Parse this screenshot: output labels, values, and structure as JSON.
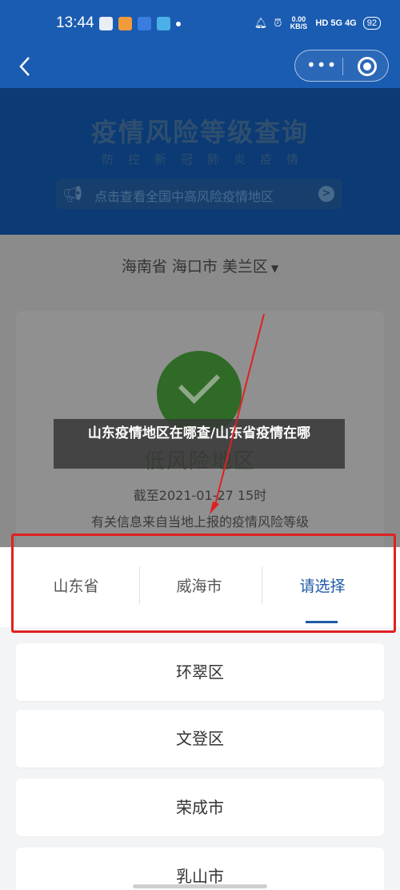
{
  "status_bar": {
    "time": "13:44",
    "speed": "0.00 KB/S",
    "network": "HD 5G 4G",
    "battery": "92"
  },
  "nav": {
    "back_icon": "chevron-left-icon",
    "more_icon": "more-dots-icon",
    "close_icon": "target-circle-icon"
  },
  "banner": {
    "title": "疫情风险等级查询",
    "subtitle": "防控新冠肺炎疫情",
    "notice": "点击查看全国中高风险疫情地区"
  },
  "region": {
    "selected": "海南省 海口市 美兰区"
  },
  "result": {
    "level": "低风险地区",
    "deadline": "截至2021-01-27 15时",
    "source": "有关信息来自当地上报的疫情风险等级"
  },
  "caption": {
    "text": "山东疫情地区在哪查/山东省疫情在哪"
  },
  "picker": {
    "tabs": [
      {
        "label": "山东省"
      },
      {
        "label": "威海市"
      },
      {
        "label": "请选择"
      }
    ],
    "items": [
      {
        "label": "环翠区"
      },
      {
        "label": "文登区"
      },
      {
        "label": "荣成市"
      },
      {
        "label": "乳山市"
      }
    ]
  },
  "colors": {
    "brand_blue": "#1a5cb1",
    "active_tab": "#1f5aa6",
    "annotation_red": "#e02020"
  }
}
